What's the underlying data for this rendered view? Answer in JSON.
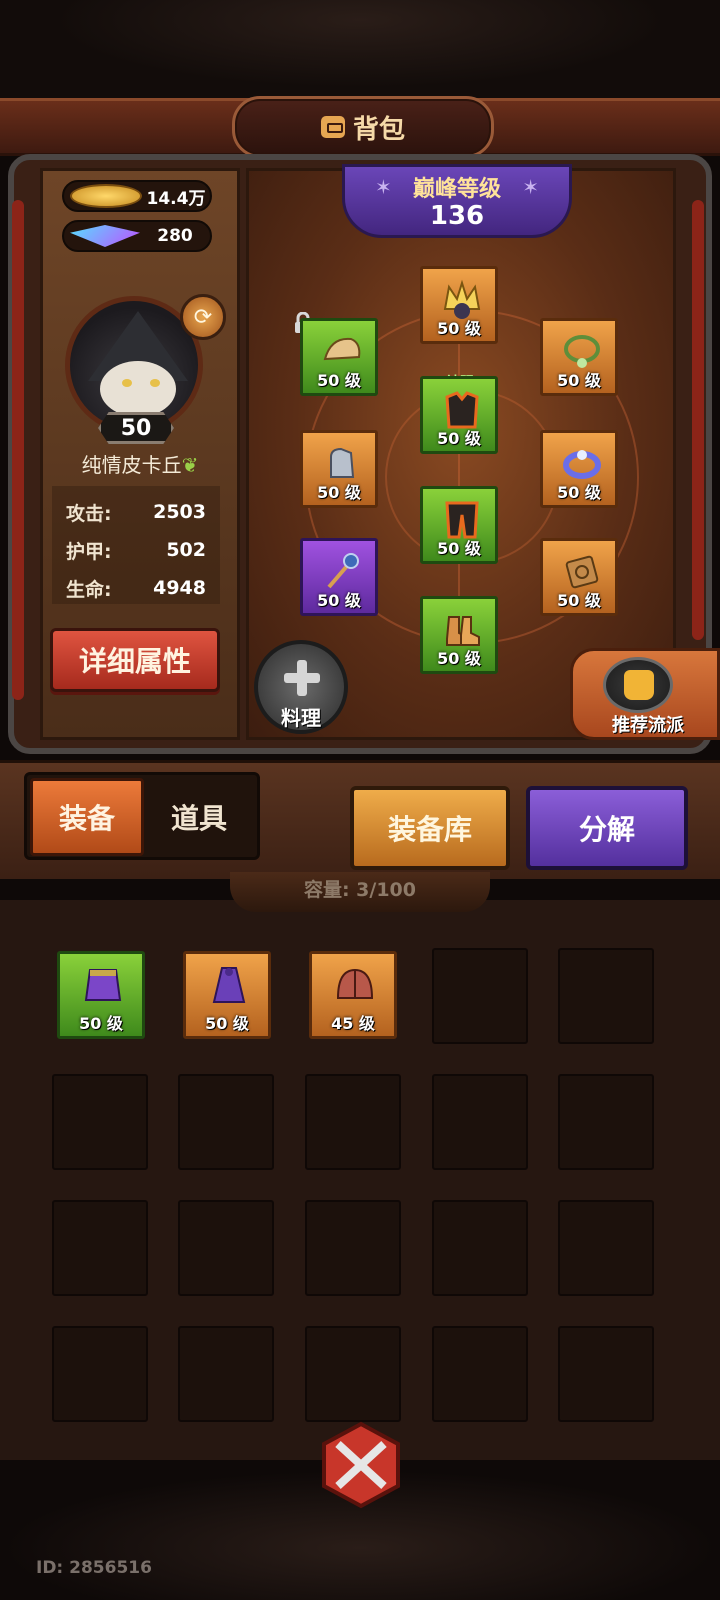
{
  "header": {
    "title": "背包",
    "icon": "bag-icon"
  },
  "currency": {
    "gold": "14.4万",
    "gems": "280"
  },
  "character": {
    "level": "50",
    "name": "纯情皮卡丘",
    "stats": [
      {
        "key": "攻击:",
        "value": "2503"
      },
      {
        "key": "护甲:",
        "value": "502"
      },
      {
        "key": "生命:",
        "value": "4948"
      }
    ],
    "detail_button": "详细属性"
  },
  "peak": {
    "title": "巅峰等级",
    "value": "136"
  },
  "equipment_slots": {
    "helmet": {
      "level": "50 级",
      "rarity": "orange",
      "art": "crown-icon"
    },
    "left_top": {
      "level": "50 级",
      "rarity": "green",
      "art": "shoulder-icon",
      "locked": true
    },
    "necklace": {
      "level": "50 级",
      "rarity": "orange",
      "art": "necklace-icon"
    },
    "armor": {
      "level": "50 级",
      "rarity": "green",
      "art": "armor-icon",
      "tag": "神赐"
    },
    "gloves": {
      "level": "50 级",
      "rarity": "orange",
      "art": "gauntlet-icon"
    },
    "ring": {
      "level": "50 级",
      "rarity": "orange",
      "art": "ring-icon"
    },
    "pants": {
      "level": "50 级",
      "rarity": "green",
      "art": "pants-icon"
    },
    "weapon": {
      "level": "50 级",
      "rarity": "purple",
      "art": "staff-icon"
    },
    "scroll": {
      "level": "50 级",
      "rarity": "orange",
      "art": "scroll-icon"
    },
    "boots": {
      "level": "50 级",
      "rarity": "green",
      "art": "boots-icon"
    }
  },
  "cook_button": "料理",
  "recommend_button": "推荐流派",
  "tabs": {
    "equip": "装备",
    "items": "道具"
  },
  "buttons": {
    "storage": "装备库",
    "decompose": "分解"
  },
  "capacity": "容量: 3/100",
  "inventory": [
    {
      "level": "50 级",
      "rarity": "green",
      "art": "purple-skirt-icon"
    },
    {
      "level": "50 级",
      "rarity": "orange",
      "art": "purple-cloak-icon"
    },
    {
      "level": "45 级",
      "rarity": "orange",
      "art": "red-helmet-icon"
    }
  ],
  "user_id": "ID: 2856516",
  "colors": {
    "green": "#6fb52c",
    "orange": "#d88736",
    "purple": "#7e3fc4",
    "red_button": "#c93e2c"
  }
}
